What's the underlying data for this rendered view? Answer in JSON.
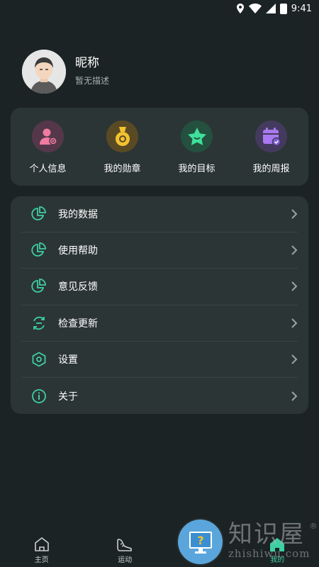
{
  "status_bar": {
    "time": "9:41"
  },
  "profile": {
    "nickname": "昵称",
    "description": "暂无描述"
  },
  "quick_actions": [
    {
      "label": "个人信息",
      "icon": "user-badge-icon",
      "color": "#f07aa0",
      "bg": "#54384a"
    },
    {
      "label": "我的勋章",
      "icon": "medal-icon",
      "color": "#f2c230",
      "bg": "#5a4a24"
    },
    {
      "label": "我的目标",
      "icon": "star-icon",
      "color": "#3ee09a",
      "bg": "#24503f"
    },
    {
      "label": "我的周报",
      "icon": "calendar-check-icon",
      "color": "#a879f0",
      "bg": "#443a5e"
    }
  ],
  "menu": [
    {
      "label": "我的数据",
      "icon": "pie-chart-icon"
    },
    {
      "label": "使用帮助",
      "icon": "pie-chart-icon"
    },
    {
      "label": "意见反馈",
      "icon": "pie-chart-icon"
    },
    {
      "label": "检查更新",
      "icon": "refresh-icon"
    },
    {
      "label": "设置",
      "icon": "hexagon-settings-icon"
    },
    {
      "label": "关于",
      "icon": "info-icon"
    }
  ],
  "bottom_nav": [
    {
      "label": "主页",
      "icon": "home-icon",
      "active": false
    },
    {
      "label": "运动",
      "icon": "shoe-icon",
      "active": false
    },
    {
      "label": "我的",
      "icon": "home-active-icon",
      "active": true
    }
  ],
  "watermark": {
    "line1": "知识屋",
    "line2": "zhishiwu.com"
  },
  "colors": {
    "background": "#1c2324",
    "card": "#2c3536",
    "accent": "#3ecfa0",
    "fab": "#5aa6dc"
  }
}
